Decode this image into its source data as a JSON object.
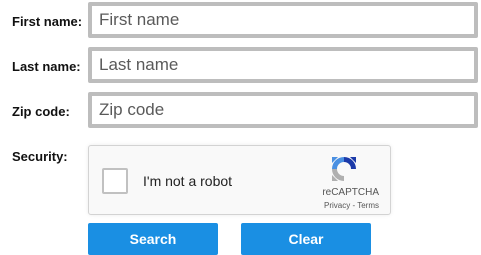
{
  "form": {
    "first_name": {
      "label": "First name:",
      "placeholder": "First name",
      "value": ""
    },
    "last_name": {
      "label": "Last name:",
      "placeholder": "Last name",
      "value": ""
    },
    "zip_code": {
      "label": "Zip code:",
      "placeholder": "Zip code",
      "value": ""
    },
    "security": {
      "label": "Security:"
    }
  },
  "recaptcha": {
    "checkbox_label": "I'm not a robot",
    "brand": "reCAPTCHA",
    "links": "Privacy - Terms",
    "checked": false,
    "icon": "recaptcha-logo-icon"
  },
  "buttons": {
    "search": "Search",
    "clear": "Clear"
  },
  "colors": {
    "button_bg": "#1a8fe3",
    "field_border": "#bdbdbd"
  }
}
